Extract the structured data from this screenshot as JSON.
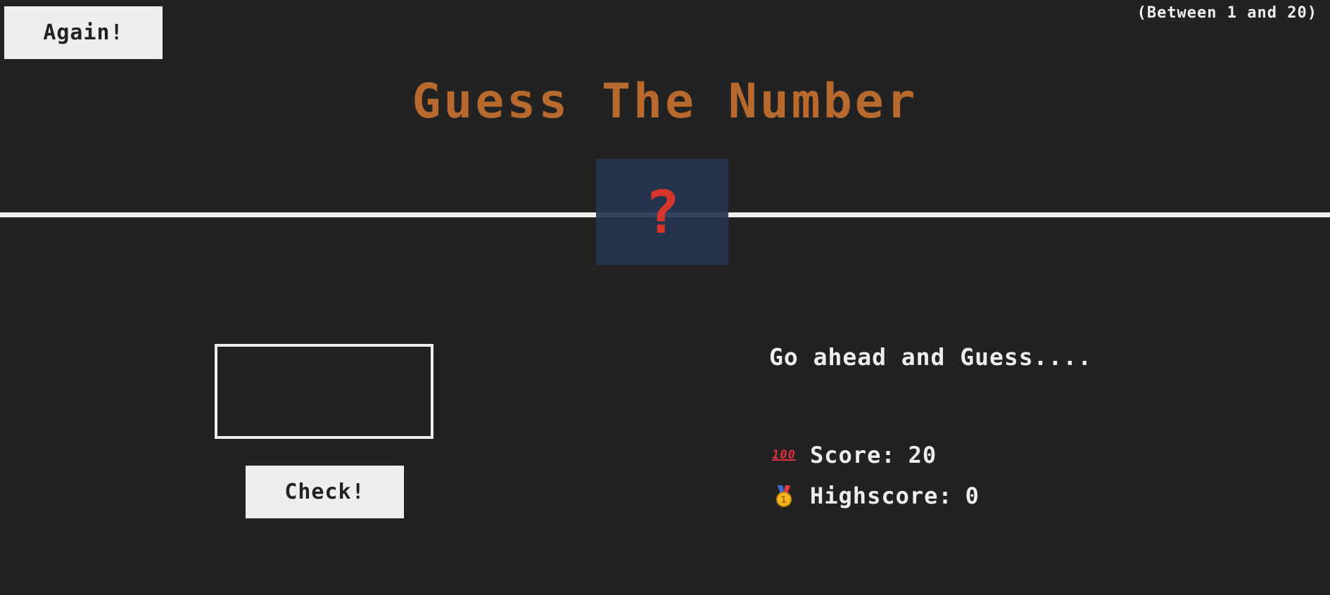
{
  "header": {
    "again_label": "Again!",
    "range_hint": "(Between 1 and 20)",
    "title": "Guess The Number"
  },
  "secret": {
    "display": "?"
  },
  "left": {
    "guess_value": "",
    "check_label": "Check!"
  },
  "right": {
    "message": "Go ahead and Guess....",
    "score_icon": "hundred-points-icon",
    "score_label": "Score:",
    "score_value": "20",
    "highscore_icon": "medal-icon",
    "highscore_label": "Highscore:",
    "highscore_value": "0"
  },
  "colors": {
    "background": "#222222",
    "title": "#b8692e",
    "secret_box": "#263450",
    "secret_mark": "#d7352a",
    "text": "#eeeeee"
  }
}
